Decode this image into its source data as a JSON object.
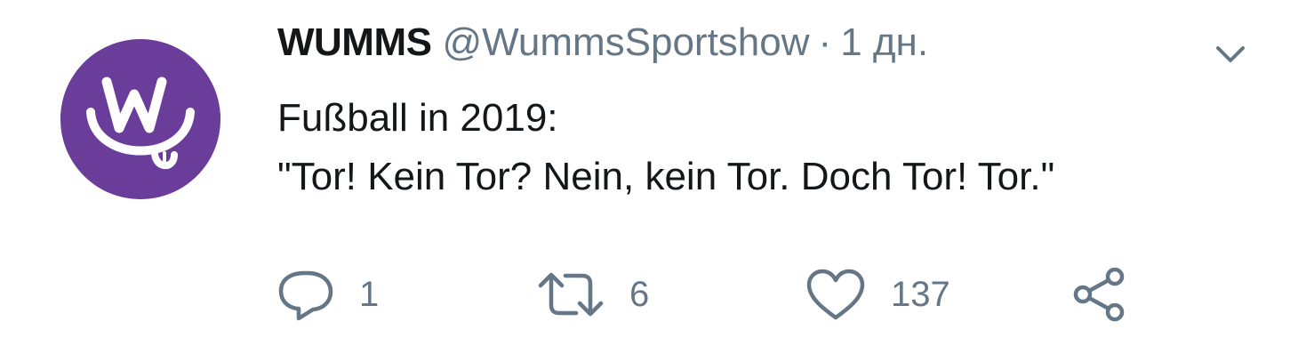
{
  "tweet": {
    "display_name": "WUMMS",
    "handle": "@WummsSportshow",
    "separator": "·",
    "time": "1 дн.",
    "text_line1": "Fußball in 2019:",
    "text_line2": "\"Tor! Kein Tor? Nein, kein Tor. Doch Tor! Tor.\"",
    "avatar_color": "#6a3d9a",
    "avatar_icon": "wumms-logo-icon",
    "menu_icon": "chevron-down-icon"
  },
  "actions": {
    "reply": {
      "icon": "reply-icon",
      "count": "1"
    },
    "retweet": {
      "icon": "retweet-icon",
      "count": "6"
    },
    "like": {
      "icon": "heart-icon",
      "count": "137"
    },
    "share": {
      "icon": "share-icon"
    }
  },
  "colors": {
    "text_primary": "#14171a",
    "text_secondary": "#657786",
    "icon": "#657786"
  }
}
